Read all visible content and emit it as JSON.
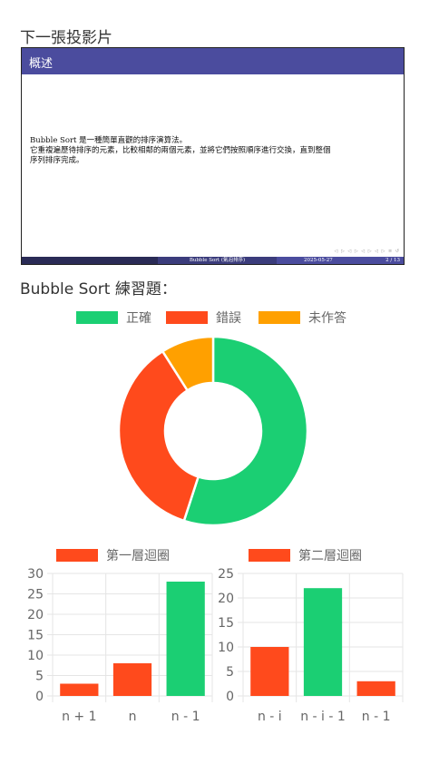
{
  "next_slide_heading": "下一張投影片",
  "slide": {
    "title": "概述",
    "line1": "Bubble Sort 是一種簡單直觀的排序演算法。",
    "line2": "它重複遍歷待排序的元素，比較相鄰的兩個元素，並將它們按照順序進行交換，直到整個",
    "line3": "序列排序完成。",
    "nav": "◁ ▷ ◁ ▷ ◁ ▷ ◁ ▷ ≡ ↺",
    "footer_title": "Bubble Sort (氣泡排序)",
    "footer_date": "2025-05-27",
    "footer_page": "2 / 13"
  },
  "exercise_heading": "Bubble Sort 練習題：",
  "colors": {
    "correct": "#1bcf73",
    "wrong": "#ff4a1c",
    "unanswered": "#ffa000"
  },
  "pie": {
    "legend": [
      "正確",
      "錯誤",
      "未作答"
    ],
    "chart_data": {
      "type": "pie",
      "categories": [
        "正確",
        "錯誤",
        "未作答"
      ],
      "values": [
        55,
        36,
        9
      ],
      "legend_position": "top"
    }
  },
  "bar1": {
    "legend": "第一層迴圈",
    "chart_data": {
      "type": "bar",
      "categories": [
        "n + 1",
        "n",
        "n - 1"
      ],
      "values": [
        3,
        8,
        28
      ],
      "bar_colors": [
        "wrong",
        "wrong",
        "correct"
      ],
      "ylim": [
        0,
        30
      ],
      "yticks": [
        0,
        5,
        10,
        15,
        20,
        25,
        30
      ],
      "grid": true
    }
  },
  "bar2": {
    "legend": "第二層迴圈",
    "chart_data": {
      "type": "bar",
      "categories": [
        "n - i",
        "n - i - 1",
        "n - 1"
      ],
      "values": [
        10,
        22,
        3
      ],
      "bar_colors": [
        "wrong",
        "correct",
        "wrong"
      ],
      "ylim": [
        0,
        25
      ],
      "yticks": [
        0,
        5,
        10,
        15,
        20,
        25
      ],
      "grid": true
    }
  }
}
